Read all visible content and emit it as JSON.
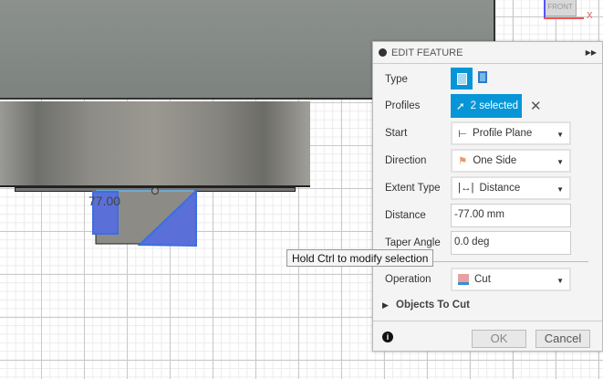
{
  "viewport": {
    "dimension_label": "77.00",
    "viewcube_label": "FRONT",
    "axis_x": "X"
  },
  "tooltip": "Hold Ctrl to modify selection",
  "panel": {
    "title": "EDIT FEATURE",
    "rows": {
      "type": "Type",
      "profiles": "Profiles",
      "profiles_value": "2 selected",
      "start": "Start",
      "start_value": "Profile Plane",
      "direction": "Direction",
      "direction_value": "One Side",
      "extent": "Extent Type",
      "extent_value": "Distance",
      "distance": "Distance",
      "distance_value": "-77.00 mm",
      "taper": "Taper Angle",
      "taper_value": "0.0 deg",
      "operation": "Operation",
      "operation_value": "Cut",
      "objects": "Objects To Cut"
    },
    "ok": "OK",
    "cancel": "Cancel"
  },
  "colors": {
    "accent": "#0696d7",
    "profile": "#5a6fd8"
  }
}
